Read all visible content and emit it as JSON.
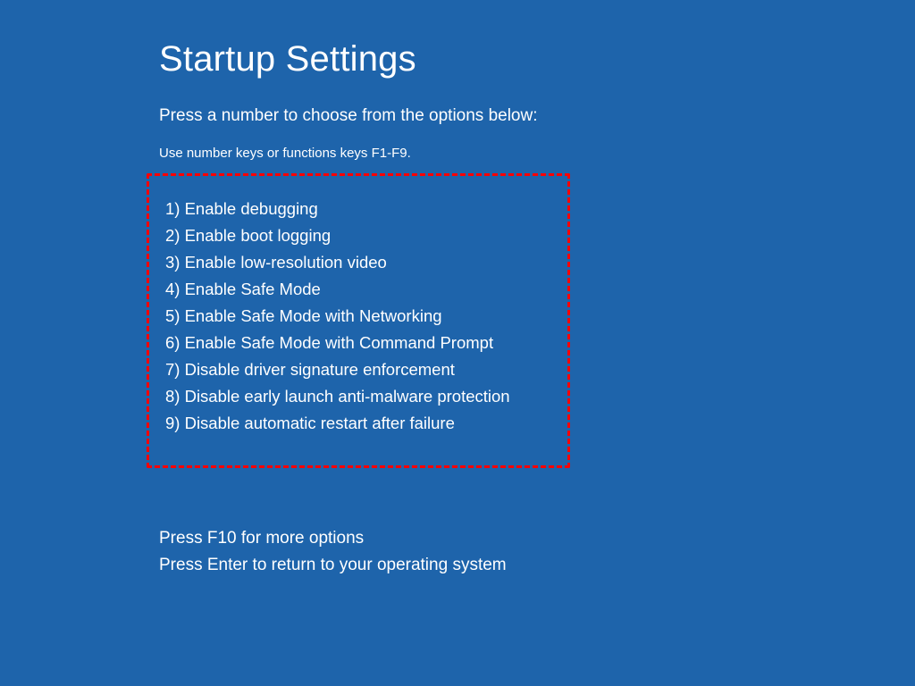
{
  "title": "Startup Settings",
  "subtitle": "Press a number to choose from the options below:",
  "hint": "Use number keys or functions keys F1-F9.",
  "options": [
    "1) Enable debugging",
    "2) Enable boot logging",
    "3) Enable low-resolution video",
    "4) Enable Safe Mode",
    "5) Enable Safe Mode with Networking",
    "6) Enable Safe Mode with Command Prompt",
    "7) Disable driver signature enforcement",
    "8) Disable early launch anti-malware protection",
    "9) Disable automatic restart after failure"
  ],
  "footer": {
    "line1": "Press F10 for more options",
    "line2": "Press Enter to return to your operating system"
  }
}
